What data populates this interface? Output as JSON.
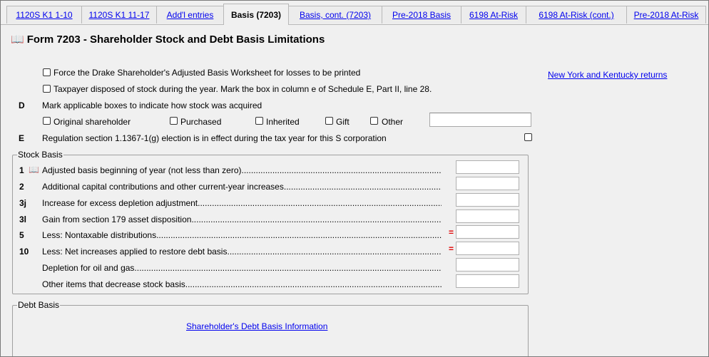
{
  "tabs": [
    {
      "label": "1120S K1 1-10",
      "active": false
    },
    {
      "label": "1120S K1 11-17",
      "active": false
    },
    {
      "label": "Add'l entries",
      "active": false
    },
    {
      "label": "Basis (7203)",
      "active": true
    },
    {
      "label": "Basis, cont. (7203)",
      "active": false
    },
    {
      "label": "Pre-2018 Basis",
      "active": false
    },
    {
      "label": "6198 At-Risk",
      "active": false
    },
    {
      "label": "6198 At-Risk (cont.)",
      "active": false
    },
    {
      "label": "Pre-2018 At-Risk",
      "active": false
    }
  ],
  "form": {
    "book_icon": "book-icon",
    "title": "Form 7203 - Shareholder Stock and Debt Basis Limitations",
    "force_worksheet_label": "Force the Drake Shareholder's Adjusted Basis Worksheet for losses to be printed",
    "disposed_label": "Taxpayer disposed of stock during the year. Mark the box in column e of Schedule E, Part II, line 28.",
    "ny_ky_link": "New York and Kentucky returns",
    "d_letter": "D",
    "d_label": "Mark applicable boxes to indicate how stock was acquired",
    "acquired": {
      "original": "Original shareholder",
      "purchased": "Purchased",
      "inherited": "Inherited",
      "gift": "Gift",
      "other": "Other",
      "other_value": ""
    },
    "e_letter": "E",
    "e_label": "Regulation section 1.1367-1(g) election is in effect during the tax year for this S corporation"
  },
  "stock_basis": {
    "legend": "Stock Basis",
    "lines": [
      {
        "num": "1",
        "book": true,
        "label": "Adjusted basis beginning of year (not less than zero)",
        "value": "",
        "adjust": false
      },
      {
        "num": "2",
        "book": false,
        "label": "Additional capital contributions and other current-year increases",
        "value": "",
        "adjust": false
      },
      {
        "num": "3j",
        "book": false,
        "label": "Increase for excess depletion adjustment",
        "value": "",
        "adjust": false
      },
      {
        "num": "3l",
        "book": false,
        "label": "Gain from section 179 asset disposition",
        "value": "",
        "adjust": false
      },
      {
        "num": "5",
        "book": false,
        "label": "Less: Nontaxable distributions",
        "value": "",
        "adjust": true
      },
      {
        "num": "10",
        "book": false,
        "label": "Less: Net increases applied to restore debt basis",
        "value": "",
        "adjust": true
      },
      {
        "num": "",
        "book": false,
        "label": "Depletion for oil and gas",
        "value": "",
        "adjust": false
      },
      {
        "num": "",
        "book": false,
        "label": "Other items that decrease stock basis",
        "value": "",
        "adjust": false
      }
    ],
    "adjust_symbol": "="
  },
  "debt_basis": {
    "legend": "Debt Basis",
    "link": "Shareholder's Debt Basis Information"
  },
  "colors": {
    "link": "#0000ee",
    "adjust_marker": "#e00000",
    "background": "#f0f0f0"
  }
}
